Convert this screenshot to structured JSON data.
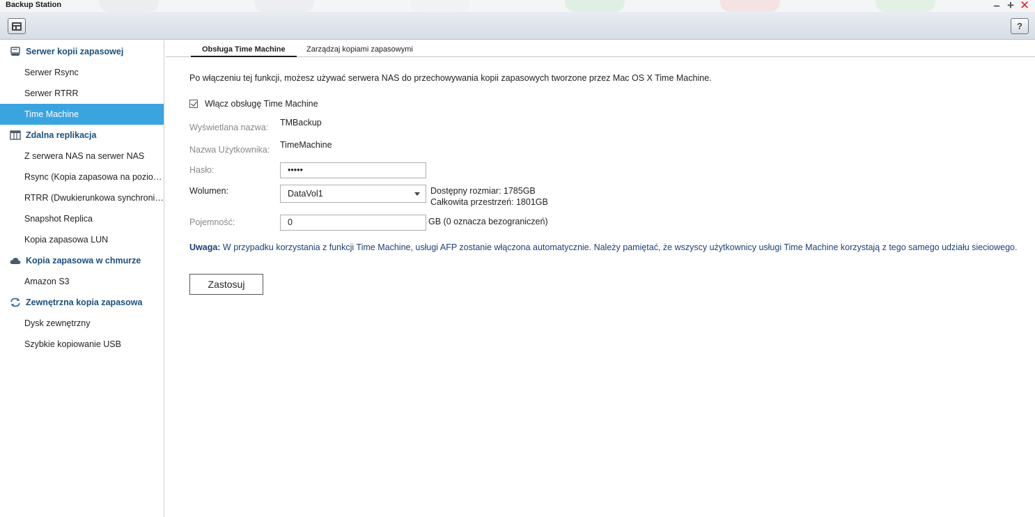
{
  "window": {
    "title": "Backup Station"
  },
  "toolbar": {
    "help_label": "?"
  },
  "sidebar": {
    "groups": [
      {
        "label": "Serwer kopii zapasowej",
        "icon": "server-icon",
        "items": [
          "Serwer Rsync",
          "Serwer RTRR",
          "Time Machine"
        ]
      },
      {
        "label": "Zdalna replikacja",
        "icon": "replication-icon",
        "items": [
          "Z serwera NAS na serwer NAS",
          "Rsync (Kopia zapasowa na pozio…",
          "RTRR (Dwukierunkowa synchroni…",
          "Snapshot Replica",
          "Kopia zapasowa LUN"
        ]
      },
      {
        "label": "Kopia zapasowa w chmurze",
        "icon": "cloud-icon",
        "items": [
          "Amazon S3"
        ]
      },
      {
        "label": "Zewnętrzna kopia zapasowa",
        "icon": "sync-arrows-icon",
        "items": [
          "Dysk zewnętrzny",
          "Szybkie kopiowanie USB"
        ]
      }
    ],
    "active_item": "Time Machine",
    "active_color": "#3aa4df"
  },
  "tabs": [
    {
      "label": "Obsługa Time Machine",
      "active": true
    },
    {
      "label": "Zarządzaj kopiami zapasowymi",
      "active": false
    }
  ],
  "form": {
    "intro": "Po włączeniu tej funkcji, możesz używać serwera NAS do przechowywania kopii zapasowych tworzone przez Mac OS X Time Machine.",
    "enable_label": "Włącz obsługę Time Machine",
    "enable_checked": true,
    "display_name_label": "Wyświetlana nazwa:",
    "display_name_value": "TMBackup",
    "username_label": "Nazwa Użytkownika:",
    "username_value": "TimeMachine",
    "password_label": "Hasło:",
    "password_value": "•••••",
    "volume_label": "Wolumen:",
    "volume_value": "DataVol1",
    "available_size": "Dostępny rozmiar: 1785GB",
    "total_space": "Całkowita przestrzeń: 1801GB",
    "capacity_label": "Pojemność:",
    "capacity_value": "0",
    "capacity_hint": "GB (0 oznacza bezograniczeń)",
    "note_prefix": "Uwaga:",
    "note_text": " W przypadku korzystania z funkcji Time Machine, usługi AFP zostanie włączona automatycznie. Należy pamiętać, że wszyscy użytkownicy usługi Time Machine korzystają z tego samego udziału sieciowego.",
    "apply_label": "Zastosuj"
  },
  "colors": {
    "group_text": "#1c4f7c",
    "note_text": "#1c3f7a",
    "close": "#d9262c"
  }
}
